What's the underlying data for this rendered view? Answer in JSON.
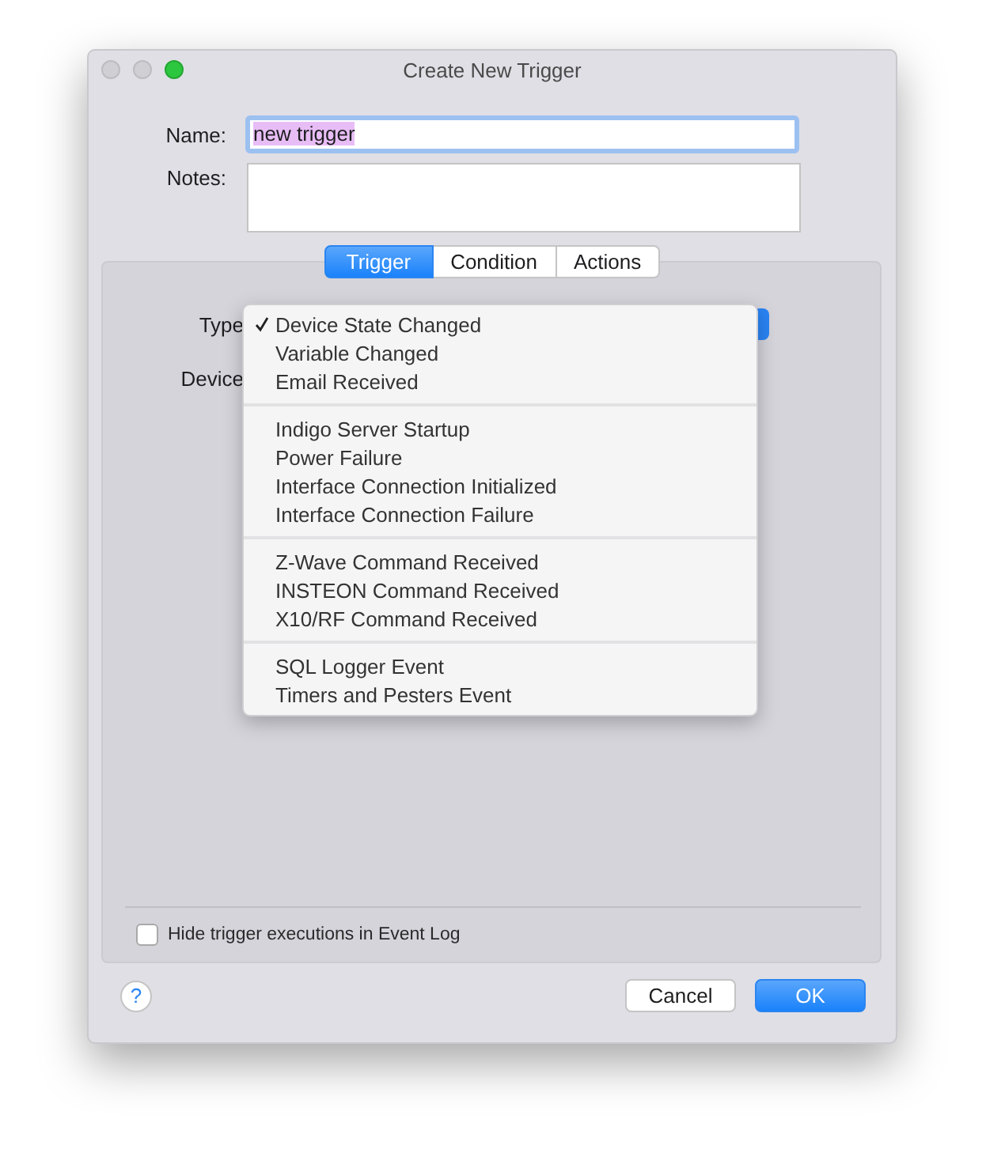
{
  "window": {
    "title": "Create New Trigger"
  },
  "form": {
    "name_label": "Name:",
    "name_value": "new trigger",
    "name_selected": true,
    "notes_label": "Notes:"
  },
  "tabs": [
    {
      "label": "Trigger",
      "selected": true
    },
    {
      "label": "Condition",
      "selected": false
    },
    {
      "label": "Actions",
      "selected": false
    }
  ],
  "trigger": {
    "type_label": "Type",
    "device_label": "Device",
    "type_menu": [
      [
        {
          "label": "Device State Changed",
          "selected": true
        },
        {
          "label": "Variable Changed",
          "selected": false
        },
        {
          "label": "Email Received",
          "selected": false
        }
      ],
      [
        {
          "label": "Indigo Server Startup",
          "selected": false
        },
        {
          "label": "Power Failure",
          "selected": false
        },
        {
          "label": "Interface Connection Initialized",
          "selected": false
        },
        {
          "label": "Interface Connection Failure",
          "selected": false
        }
      ],
      [
        {
          "label": "Z-Wave Command Received",
          "selected": false
        },
        {
          "label": "INSTEON Command Received",
          "selected": false
        },
        {
          "label": "X10/RF Command Received",
          "selected": false
        }
      ],
      [
        {
          "label": "SQL Logger Event",
          "selected": false
        },
        {
          "label": "Timers and Pesters Event",
          "selected": false
        }
      ]
    ]
  },
  "hide_executions": {
    "label": "Hide trigger executions in Event Log",
    "checked": false
  },
  "help": {
    "label": "?"
  },
  "buttons": [
    {
      "label": "Cancel",
      "kind": "default"
    },
    {
      "label": "OK",
      "kind": "primary"
    }
  ]
}
